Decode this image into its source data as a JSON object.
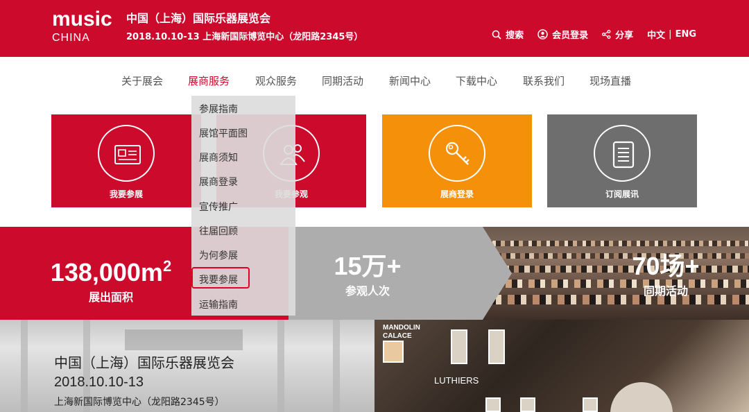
{
  "header": {
    "logo_main": "music",
    "logo_sub": "CHINA",
    "event_title": "中国（上海）国际乐器展览会",
    "event_subtitle": "2018.10.10-13 上海新国际博览中心（龙阳路2345号）",
    "actions": {
      "search": "搜索",
      "login": "会员登录",
      "share": "分享",
      "lang_zh": "中文",
      "lang_sep": "|",
      "lang_en": "ENG"
    },
    "bg_color": "#cc0a2c"
  },
  "nav": {
    "items": [
      {
        "label": "关于展会"
      },
      {
        "label": "展商服务"
      },
      {
        "label": "观众服务"
      },
      {
        "label": "同期活动"
      },
      {
        "label": "新闻中心"
      },
      {
        "label": "下载中心"
      },
      {
        "label": "联系我们"
      },
      {
        "label": "现场直播"
      }
    ],
    "active_index": 1,
    "active_color": "#cc0a2c"
  },
  "dropdown": {
    "items": [
      {
        "label": "参展指南"
      },
      {
        "label": "展馆平面图"
      },
      {
        "label": "展商须知"
      },
      {
        "label": "展商登录"
      },
      {
        "label": "宣传推广"
      },
      {
        "label": "往届回顾"
      },
      {
        "label": "为何参展"
      },
      {
        "label": "我要参展"
      },
      {
        "label": "运输指南"
      }
    ],
    "highlighted": "我要参展"
  },
  "tiles": [
    {
      "label": "我要参展",
      "color": "#cc0a2c",
      "icon": "id-card-icon"
    },
    {
      "label": "我要参观",
      "color": "#cc0a2c",
      "icon": "users-icon"
    },
    {
      "label": "展商登录",
      "color": "#f5900b",
      "icon": "key-icon"
    },
    {
      "label": "订阅展讯",
      "color": "#6e6e6e",
      "icon": "document-icon"
    }
  ],
  "stats": {
    "area_value": "138,000m",
    "area_sup": "2",
    "area_label": "展出面积",
    "visitors_value": "15万+",
    "visitors_label": "参观人次",
    "events_value": "70场+",
    "events_label": "同期活动"
  },
  "lower": {
    "title": "中国（上海）国际乐器展览会",
    "date": "2018.10.10-13",
    "address": "上海新国际博览中心（龙阳路2345号）",
    "poster_text_1": "MANDOLIN",
    "poster_text_2": "CALACE",
    "poster_text_3": "LUTHIERS"
  }
}
